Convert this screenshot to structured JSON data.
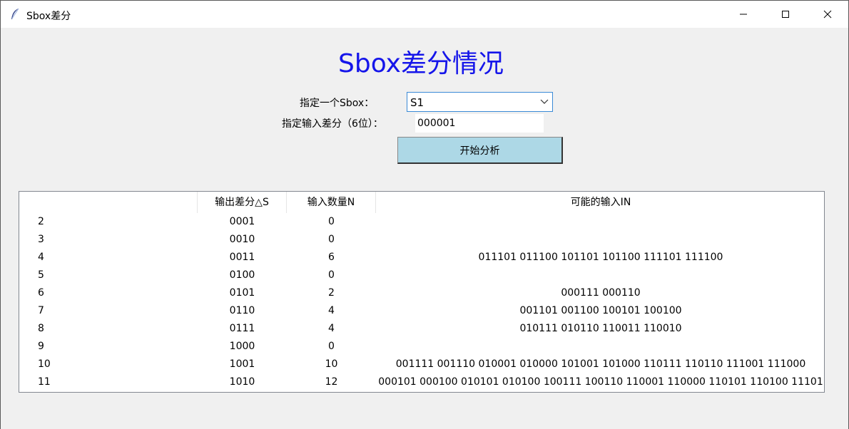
{
  "window": {
    "title": "Sbox差分",
    "icon": "feather-icon",
    "controls": [
      "minimize-icon",
      "maximize-icon",
      "close-icon"
    ]
  },
  "heading": "Sbox差分情况",
  "form": {
    "sbox_label": "指定一个Sbox：",
    "sbox_value": "S1",
    "diff_label": "指定输入差分（6位）：",
    "diff_value": "000001",
    "start_button": "开始分析"
  },
  "table": {
    "columns": [
      "",
      "输出差分△S",
      "输入数量N",
      "可能的输入IN"
    ],
    "rows": [
      {
        "idx": "2",
        "s": "0001",
        "n": "0",
        "inputs": ""
      },
      {
        "idx": "3",
        "s": "0010",
        "n": "0",
        "inputs": ""
      },
      {
        "idx": "4",
        "s": "0011",
        "n": "6",
        "inputs": "011101 011100 101101 101100 111101 111100"
      },
      {
        "idx": "5",
        "s": "0100",
        "n": "0",
        "inputs": ""
      },
      {
        "idx": "6",
        "s": "0101",
        "n": "2",
        "inputs": "000111 000110"
      },
      {
        "idx": "7",
        "s": "0110",
        "n": "4",
        "inputs": "001101 001100 100101 100100"
      },
      {
        "idx": "8",
        "s": "0111",
        "n": "4",
        "inputs": "010111 010110 110011 110010"
      },
      {
        "idx": "9",
        "s": "1000",
        "n": "0",
        "inputs": ""
      },
      {
        "idx": "10",
        "s": "1001",
        "n": "10",
        "inputs": "001111 001110 010001 010000 101001 101000 110111 110110 111001 111000"
      },
      {
        "idx": "11",
        "s": "1010",
        "n": "12",
        "inputs": "000101 000100 010101 010100 100111 100110 110001 110000 110101 110100 11101"
      }
    ]
  },
  "colors": {
    "heading": "#1515ea",
    "button_bg": "#add8e6",
    "combo_border": "#3a8ad6"
  }
}
